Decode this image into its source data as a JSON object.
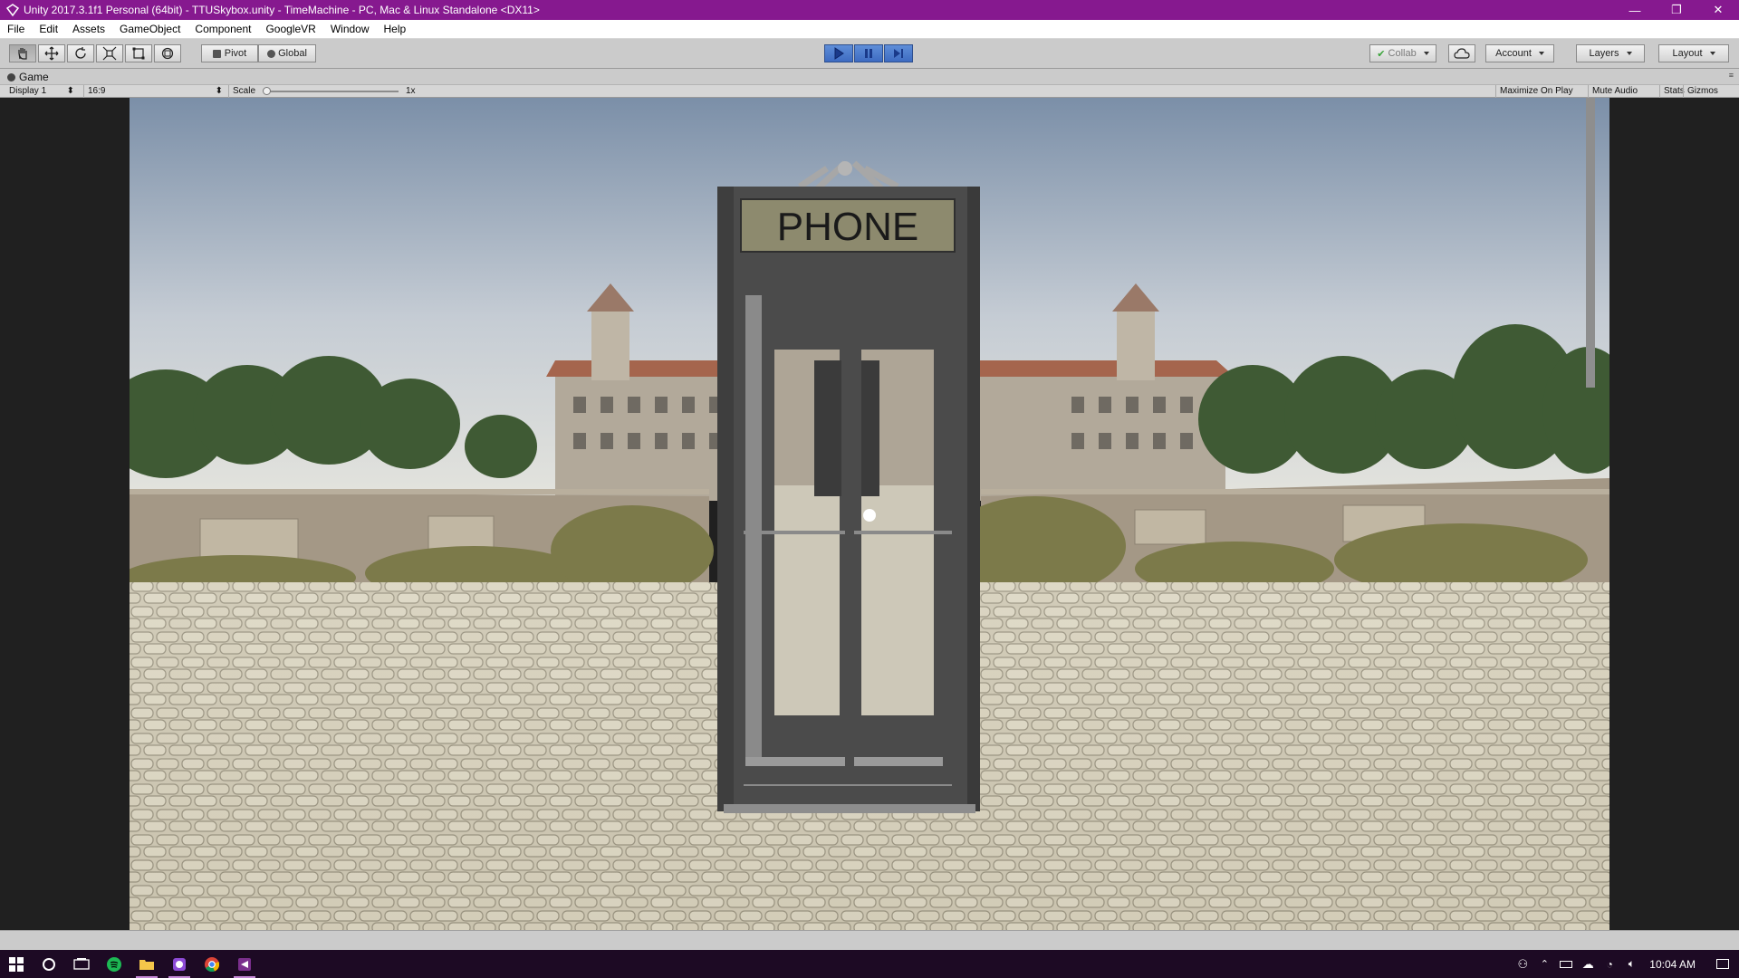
{
  "window": {
    "title": "Unity 2017.3.1f1 Personal (64bit) - TTUSkybox.unity - TimeMachine - PC, Mac & Linux Standalone <DX11>",
    "minimize": "—",
    "restore": "❐",
    "close": "✕"
  },
  "menu": [
    "File",
    "Edit",
    "Assets",
    "GameObject",
    "Component",
    "GoogleVR",
    "Window",
    "Help"
  ],
  "toolbar": {
    "pivot_label": "Pivot",
    "global_label": "Global",
    "collab_label": "Collab",
    "account_label": "Account",
    "layers_label": "Layers",
    "layout_label": "Layout",
    "tools": [
      "hand-tool",
      "move-tool",
      "rotate-tool",
      "scale-tool",
      "rect-tool",
      "transform-tool"
    ],
    "active_tool": "hand-tool"
  },
  "game_view": {
    "tab_label": "Game",
    "display": "Display 1",
    "aspect": "16:9",
    "scale_label": "Scale",
    "scale_value": "1x",
    "maximize_on_play": "Maximize On Play",
    "mute_audio": "Mute Audio",
    "stats": "Stats",
    "gizmos": "Gizmos"
  },
  "scene": {
    "booth_sign": "PHONE"
  },
  "taskbar": {
    "apps": [
      "windows-start",
      "cortana",
      "task-view",
      "spotify",
      "file-explorer",
      "app-purple",
      "chrome",
      "unity"
    ],
    "time": "10:04 AM"
  }
}
